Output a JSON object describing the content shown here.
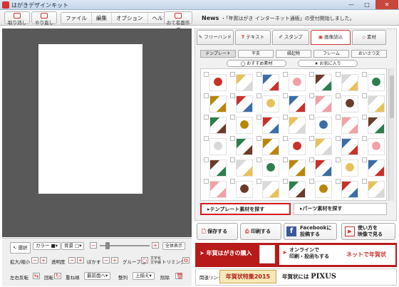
{
  "window": {
    "title": "はがきデザインキット",
    "minimize": "—",
    "maximize": "□",
    "close": "✕"
  },
  "toolbar": {
    "undo": "取り消し",
    "redo": "やり直し",
    "menu": [
      "ファイル",
      "編集",
      "オプション",
      "ヘルプ"
    ],
    "nameplate": "おて名面作成",
    "news_label": "News",
    "news_text": "・「年賀はがき インターネット通販」の受付開始しました。"
  },
  "left": {
    "select": "選択",
    "color": "カラー",
    "background": "背景",
    "show_all": "全体表示",
    "zoom_minus": "−",
    "zoom_plus": "+",
    "scale": "拡大/縮小",
    "opacity": "透明度",
    "blur": "ぼかす",
    "group": "グループ化",
    "text_label": "文字化",
    "border": "文字縁",
    "trim": "トリミング",
    "flip": "左右反転",
    "rotate": "回転",
    "overlap": "重ね順",
    "front": "最前面へ",
    "align": "整列",
    "top": "上揃え",
    "delete": "削除"
  },
  "right": {
    "tabs": [
      "フリーハンド",
      "テキスト",
      "スタンプ",
      "画像読込",
      "素材"
    ],
    "subtabs": [
      "テンプレート",
      "干支",
      "縁起物",
      "フレーム",
      "おいさつ文"
    ],
    "recommend": "おすすめ素材",
    "favorites": "お気に入り",
    "find_template": "テンプレート素材を探す",
    "find_parts": "パーツ素材を探す"
  },
  "actions": {
    "save": "保存する",
    "print": "印刷する",
    "facebook": "Facebookに\n投稿する",
    "video": "使い方を\n映像で見る"
  },
  "promo": {
    "buy": "年賀はがきの購入",
    "online": "オンラインで\n印刷・投函もする",
    "net": "ネットで年賀状",
    "links": "関連リンク",
    "feature": "年賀状特集2015",
    "pixus": "年賀状には",
    "pixus_brand": "PIXUS"
  },
  "colors": {
    "accent": "#d71a1a",
    "banner": "#b81a1a"
  }
}
